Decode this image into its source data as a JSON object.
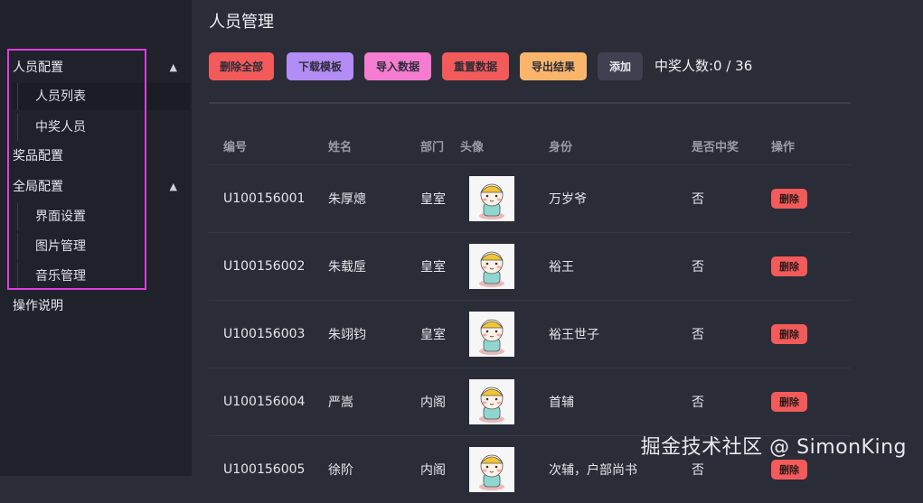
{
  "sidebar": {
    "groups": [
      {
        "label": "人员配置",
        "expanded": true,
        "items": [
          {
            "label": "人员列表",
            "active": true
          },
          {
            "label": "中奖人员",
            "active": false
          }
        ]
      },
      {
        "label": "奖品配置"
      },
      {
        "label": "全局配置",
        "expanded": true,
        "items": [
          {
            "label": "界面设置"
          },
          {
            "label": "图片管理"
          },
          {
            "label": "音乐管理"
          }
        ]
      },
      {
        "label": "操作说明"
      }
    ]
  },
  "page": {
    "title": "人员管理"
  },
  "toolbar": {
    "buttons": [
      {
        "label": "删除全部",
        "color": "#f35a5a"
      },
      {
        "label": "下载模板",
        "color": "#b48cf5"
      },
      {
        "label": "导入数据",
        "color": "#f57cd0"
      },
      {
        "label": "重置数据",
        "color": "#f35a5a"
      },
      {
        "label": "导出结果",
        "color": "#fbb56b"
      },
      {
        "label": "添加",
        "color": "#3f4150"
      }
    ],
    "winner_count": "中奖人数:0 / 36"
  },
  "table": {
    "headers": [
      "编号",
      "姓名",
      "部门",
      "头像",
      "身份",
      "是否中奖",
      "操作"
    ],
    "rows": [
      {
        "id": "U100156001",
        "name": "朱厚熜",
        "dept": "皇室",
        "identity": "万岁爷",
        "winner": "否",
        "action": "删除"
      },
      {
        "id": "U100156002",
        "name": "朱载垕",
        "dept": "皇室",
        "identity": "裕王",
        "winner": "否",
        "action": "删除"
      },
      {
        "id": "U100156003",
        "name": "朱翊钧",
        "dept": "皇室",
        "identity": "裕王世子",
        "winner": "否",
        "action": "删除"
      },
      {
        "id": "U100156004",
        "name": "严嵩",
        "dept": "内阁",
        "identity": "首辅",
        "winner": "否",
        "action": "删除"
      },
      {
        "id": "U100156005",
        "name": "徐阶",
        "dept": "内阁",
        "identity": "次辅，户部尚书",
        "winner": "否",
        "action": "删除"
      }
    ]
  },
  "watermark": "掘金技术社区 @ SimonKing",
  "icons": {
    "chevron": "chevron-up-icon",
    "avatar": "cartoon-avatar-icon"
  }
}
